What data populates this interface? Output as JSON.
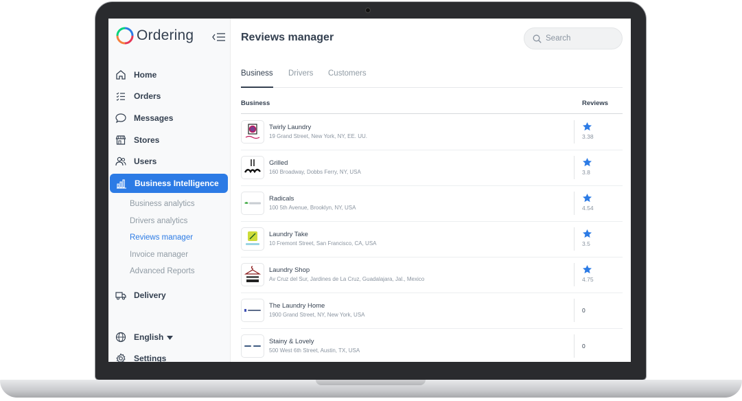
{
  "app": {
    "name": "Ordering"
  },
  "sidebar": {
    "items": [
      {
        "label": "Home",
        "icon": "home-icon"
      },
      {
        "label": "Orders",
        "icon": "list-icon"
      },
      {
        "label": "Messages",
        "icon": "chat-icon"
      },
      {
        "label": "Stores",
        "icon": "shop-icon"
      },
      {
        "label": "Users",
        "icon": "users-icon"
      },
      {
        "label": "Business Intelligence",
        "icon": "bar-chart-icon",
        "active": true
      }
    ],
    "sub_items": [
      {
        "label": "Business analytics"
      },
      {
        "label": "Drivers analytics"
      },
      {
        "label": "Reviews manager",
        "active": true
      },
      {
        "label": "Invoice manager"
      },
      {
        "label": "Advanced Reports"
      }
    ],
    "delivery": {
      "label": "Delivery",
      "icon": "truck-icon"
    },
    "language": {
      "label": "English",
      "icon": "globe-icon"
    },
    "settings": {
      "label": "Settings",
      "icon": "gear-icon"
    }
  },
  "header": {
    "title": "Reviews manager",
    "search_placeholder": "Search"
  },
  "tabs": [
    {
      "label": "Business",
      "active": true
    },
    {
      "label": "Drivers"
    },
    {
      "label": "Customers"
    }
  ],
  "table": {
    "columns": {
      "business": "Business",
      "reviews": "Reviews"
    },
    "rows": [
      {
        "name": "Twirly Laundry",
        "address": "19 Grand Street, New York, NY, EE. UU.",
        "rating": "3.38",
        "has_star": true
      },
      {
        "name": "Grilled",
        "address": "160 Broadway, Dobbs Ferry, NY, USA",
        "rating": "3.8",
        "has_star": true
      },
      {
        "name": "Radicals",
        "address": "100 5th Avenue, Brooklyn, NY, USA",
        "rating": "4.54",
        "has_star": true
      },
      {
        "name": "Laundry Take",
        "address": "10 Fremont Street, San Francisco, CA, USA",
        "rating": "3.5",
        "has_star": true
      },
      {
        "name": "Laundry Shop",
        "address": "Av Cruz del Sur, Jardines de La Cruz, Guadalajara, Jal., Mexico",
        "rating": "4.75",
        "has_star": true
      },
      {
        "name": "The Laundry Home",
        "address": "1900 Grand Street, NY, New York, USA",
        "rating": "0",
        "has_star": false
      },
      {
        "name": "Stainy & Lovely",
        "address": "500 West 6th Street, Austin, TX, USA",
        "rating": "0",
        "has_star": false
      }
    ]
  },
  "colors": {
    "accent": "#2c7be5",
    "text": "#344050",
    "muted": "#909ba4",
    "star": "#2c7be5"
  }
}
